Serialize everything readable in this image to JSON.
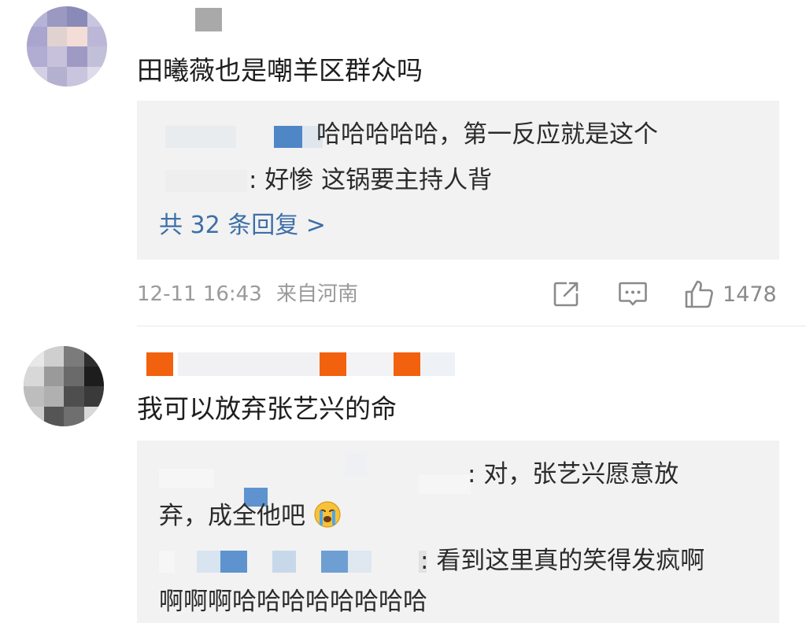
{
  "comments": [
    {
      "text": "田曦薇也是嘲羊区群众吗",
      "replies": [
        {
          "name_suffix": "",
          "text": "哈哈哈哈哈，第一反应就是这个"
        },
        {
          "name_suffix": ":",
          "text": "好惨 这锅要主持人背"
        }
      ],
      "more_replies": "共 32 条回复 >",
      "date": "12-11 16:43",
      "location": "来自河南",
      "likes": "1478"
    },
    {
      "text": "我可以放弃张艺兴的命",
      "replies": [
        {
          "name_suffix": ":",
          "text": "对，张艺兴愿意放",
          "text_cont": "弃，成全他吧"
        },
        {
          "name_suffix": ":",
          "text": "看到这里真的笑得发疯啊",
          "text_cont": "啊啊啊哈哈哈哈哈哈哈哈"
        }
      ]
    }
  ],
  "icons": {
    "share": "share-icon",
    "comment": "comment-icon",
    "like": "thumbs-up-icon",
    "emoji": "crying-emoji-icon"
  },
  "colors": {
    "link": "#3d6fa8",
    "meta": "#9a9a9a",
    "reply_bg": "#f2f2f2",
    "badge_orange": "#f2610d"
  }
}
